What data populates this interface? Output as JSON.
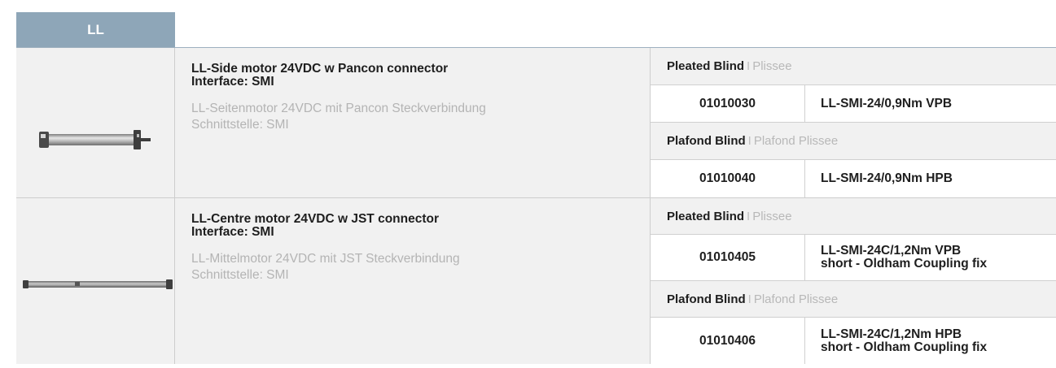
{
  "header": {
    "series_label": "LL"
  },
  "products": [
    {
      "title_en": "LL-Side motor 24VDC w Pancon connector",
      "interface_en": "Interface: SMI",
      "title_de": "LL-Seitenmotor 24VDC mit Pancon Steckverbindung",
      "interface_de": "Schnittstelle: SMI",
      "groups": [
        {
          "label_en": "Pleated Blind",
          "separator": "I",
          "label_de": "Plissee",
          "item": {
            "code": "01010030",
            "name_line1": "LL-SMI-24/0,9Nm VPB",
            "name_line2": ""
          }
        },
        {
          "label_en": "Plafond Blind",
          "separator": "I",
          "label_de": "Plafond Plissee",
          "item": {
            "code": "01010040",
            "name_line1": "LL-SMI-24/0,9Nm HPB",
            "name_line2": ""
          }
        }
      ]
    },
    {
      "title_en": "LL-Centre motor 24VDC w JST connector",
      "interface_en": "Interface: SMI",
      "title_de": "LL-Mittelmotor 24VDC mit JST Steckverbindung",
      "interface_de": "Schnittstelle: SMI",
      "groups": [
        {
          "label_en": "Pleated Blind",
          "separator": "I",
          "label_de": "Plissee",
          "item": {
            "code": "01010405",
            "name_line1": "LL-SMI-24C/1,2Nm VPB",
            "name_line2": "short - Oldham Coupling fix"
          }
        },
        {
          "label_en": "Plafond Blind",
          "separator": "I",
          "label_de": "Plafond Plissee",
          "item": {
            "code": "01010406",
            "name_line1": "LL-SMI-24C/1,2Nm HPB",
            "name_line2": "short - Oldham Coupling fix"
          }
        }
      ]
    }
  ]
}
